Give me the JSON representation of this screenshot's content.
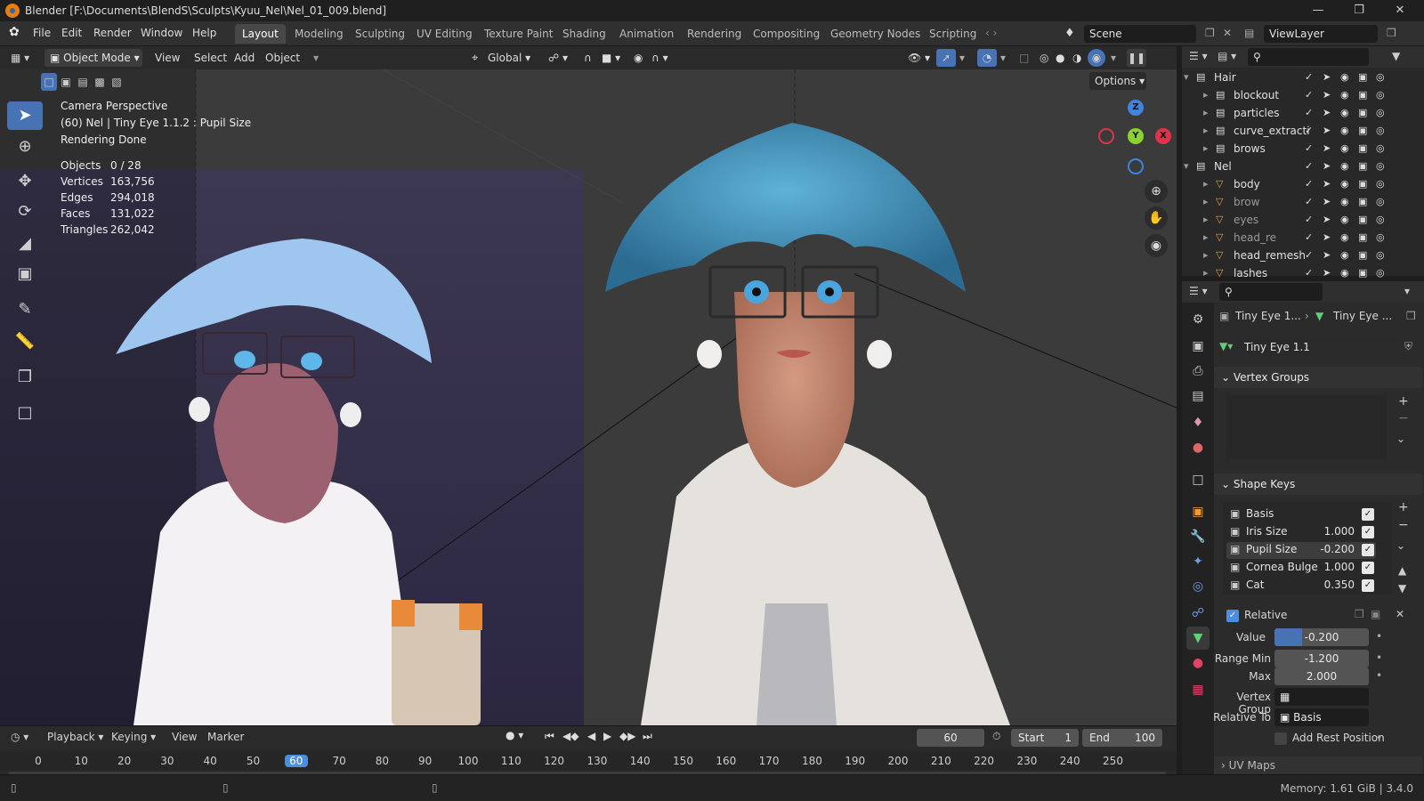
{
  "title_bar": {
    "title": "Blender [F:\\Documents\\BlendS\\Sculpts\\Kyuu_Nel\\Nel_01_009.blend]"
  },
  "menu": {
    "items": [
      "File",
      "Edit",
      "Render",
      "Window",
      "Help"
    ]
  },
  "workspaces": [
    "Layout",
    "Modeling",
    "Sculpting",
    "UV Editing",
    "Texture Paint",
    "Shading",
    "Animation",
    "Rendering",
    "Compositing",
    "Geometry Nodes",
    "Scripting"
  ],
  "scene": {
    "name": "Scene",
    "view_layer": "ViewLayer"
  },
  "viewport_header": {
    "mode": "Object Mode",
    "menus": [
      "View",
      "Select",
      "Add",
      "Object"
    ],
    "transform_orientation": "Global",
    "options": "Options"
  },
  "overlay_info": {
    "line1": "Camera Perspective",
    "line2": "(60) Nel | Tiny Eye 1.1.2 : Pupil Size",
    "line3": "Rendering Done",
    "stats": [
      {
        "label": "Objects",
        "value": "0 / 28"
      },
      {
        "label": "Vertices",
        "value": "163,756"
      },
      {
        "label": "Edges",
        "value": "294,018"
      },
      {
        "label": "Faces",
        "value": "131,022"
      },
      {
        "label": "Triangles",
        "value": "262,042"
      }
    ]
  },
  "gizmo": {
    "z": "Z",
    "y": "Y",
    "x": "X"
  },
  "outliner": {
    "rows": [
      {
        "name": "Hair",
        "type": "collection"
      },
      {
        "name": "blockout",
        "type": "collection"
      },
      {
        "name": "particles",
        "type": "collection"
      },
      {
        "name": "curve_extracti",
        "type": "collection"
      },
      {
        "name": "brows",
        "type": "collection"
      },
      {
        "name": "Nel",
        "type": "collection"
      },
      {
        "name": "body",
        "type": "mesh"
      },
      {
        "name": "brow",
        "type": "mesh"
      },
      {
        "name": "eyes",
        "type": "mesh"
      },
      {
        "name": "head_re",
        "type": "mesh"
      },
      {
        "name": "head_remesh",
        "type": "mesh"
      },
      {
        "name": "lashes",
        "type": "mesh"
      }
    ]
  },
  "properties": {
    "breadcrumb1": "Tiny Eye 1...",
    "breadcrumb2": "Tiny Eye ...",
    "data_name": "Tiny Eye 1.1",
    "vertex_groups_label": "Vertex Groups",
    "shape_keys_label": "Shape Keys",
    "shape_keys": [
      {
        "name": "Basis",
        "value": ""
      },
      {
        "name": "Iris Size",
        "value": "1.000"
      },
      {
        "name": "Pupil Size",
        "value": "-0.200"
      },
      {
        "name": "Cornea Bulge",
        "value": "1.000"
      },
      {
        "name": "Cat",
        "value": "0.350"
      }
    ],
    "relative_label": "Relative",
    "value_label": "Value",
    "value": "-0.200",
    "value_fill": 0.29,
    "range_min_label": "Range Min",
    "range_min": "-1.200",
    "max_label": "Max",
    "max": "2.000",
    "vertex_group_label": "Vertex Group",
    "relative_to_label": "Relative To",
    "relative_to": "Basis",
    "add_rest_label": "Add Rest Position",
    "next_panel": "UV Maps"
  },
  "timeline": {
    "menus": [
      "Playback",
      "Keying",
      "View",
      "Marker"
    ],
    "current_frame": "60",
    "start_label": "Start",
    "start": "1",
    "end_label": "End",
    "end": "100",
    "ruler": [
      "0",
      "10",
      "20",
      "30",
      "40",
      "50",
      "60",
      "70",
      "80",
      "90",
      "100",
      "110",
      "120",
      "130",
      "140",
      "150",
      "160",
      "170",
      "180",
      "190",
      "200",
      "210",
      "220",
      "230",
      "240",
      "250"
    ]
  },
  "status_bar": {
    "memory": "Memory: 1.61 GiB | 3.4.0"
  },
  "colors": {
    "accent": "#4772b3",
    "active_frame": "#4b8de0",
    "axis_x": "#e0334a",
    "axis_y": "#8bd12f",
    "axis_z": "#3f85dd"
  }
}
